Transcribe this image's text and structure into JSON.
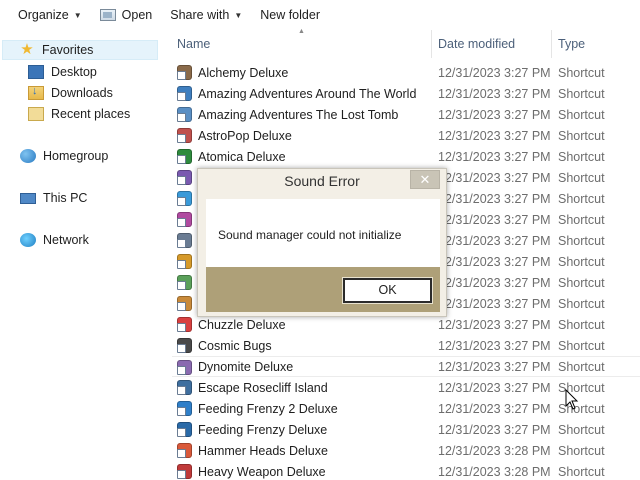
{
  "toolbar": {
    "organize": "Organize",
    "open": "Open",
    "share_with": "Share with",
    "new_folder": "New folder"
  },
  "nav": {
    "favorites": "Favorites",
    "desktop": "Desktop",
    "downloads": "Downloads",
    "recent_places": "Recent places",
    "homegroup": "Homegroup",
    "this_pc": "This PC",
    "network": "Network"
  },
  "columns": {
    "name": "Name",
    "date_modified": "Date modified",
    "type": "Type"
  },
  "files": [
    {
      "name": "Alchemy Deluxe",
      "date": "12/31/2023 3:27 PM",
      "type": "Shortcut",
      "icon_color": "#8a6a4a"
    },
    {
      "name": "Amazing Adventures Around The World",
      "date": "12/31/2023 3:27 PM",
      "type": "Shortcut",
      "icon_color": "#3f7fbf"
    },
    {
      "name": "Amazing Adventures The Lost Tomb",
      "date": "12/31/2023 3:27 PM",
      "type": "Shortcut",
      "icon_color": "#5a8fc4"
    },
    {
      "name": "AstroPop Deluxe",
      "date": "12/31/2023 3:27 PM",
      "type": "Shortcut",
      "icon_color": "#c0504d"
    },
    {
      "name": "Atomica Deluxe",
      "date": "12/31/2023 3:27 PM",
      "type": "Shortcut",
      "icon_color": "#2e8b3e"
    },
    {
      "name": "",
      "date": "12/31/2023 3:27 PM",
      "type": "Shortcut",
      "icon_color": "#7a5ab0"
    },
    {
      "name": "",
      "date": "12/31/2023 3:27 PM",
      "type": "Shortcut",
      "icon_color": "#3a9ad9"
    },
    {
      "name": "",
      "date": "12/31/2023 3:27 PM",
      "type": "Shortcut",
      "icon_color": "#b04aa0"
    },
    {
      "name": "",
      "date": "12/31/2023 3:27 PM",
      "type": "Shortcut",
      "icon_color": "#6a7c93"
    },
    {
      "name": "",
      "date": "12/31/2023 3:27 PM",
      "type": "Shortcut",
      "icon_color": "#d69a2a"
    },
    {
      "name": "",
      "date": "12/31/2023 3:27 PM",
      "type": "Shortcut",
      "icon_color": "#5aa05a"
    },
    {
      "name": "",
      "date": "12/31/2023 3:27 PM",
      "type": "Shortcut",
      "icon_color": "#c98a3a"
    },
    {
      "name": "Chuzzle Deluxe",
      "date": "12/31/2023 3:27 PM",
      "type": "Shortcut",
      "icon_color": "#d94040"
    },
    {
      "name": "Cosmic Bugs",
      "date": "12/31/2023 3:27 PM",
      "type": "Shortcut",
      "icon_color": "#4a4a4a"
    },
    {
      "name": "Dynomite Deluxe",
      "date": "12/31/2023 3:27 PM",
      "type": "Shortcut",
      "icon_color": "#8a6ab0"
    },
    {
      "name": "Escape Rosecliff Island",
      "date": "12/31/2023 3:27 PM",
      "type": "Shortcut",
      "icon_color": "#3f6f9f"
    },
    {
      "name": "Feeding Frenzy 2 Deluxe",
      "date": "12/31/2023 3:27 PM",
      "type": "Shortcut",
      "icon_color": "#2f7fc9"
    },
    {
      "name": "Feeding Frenzy Deluxe",
      "date": "12/31/2023 3:27 PM",
      "type": "Shortcut",
      "icon_color": "#2a6aa8"
    },
    {
      "name": "Hammer Heads Deluxe",
      "date": "12/31/2023 3:28 PM",
      "type": "Shortcut",
      "icon_color": "#d9593a"
    },
    {
      "name": "Heavy Weapon Deluxe",
      "date": "12/31/2023 3:28 PM",
      "type": "Shortcut",
      "icon_color": "#c03a3a"
    }
  ],
  "dialog": {
    "title": "Sound Error",
    "close": "✕",
    "message": "Sound manager could not initialize",
    "ok": "OK"
  }
}
